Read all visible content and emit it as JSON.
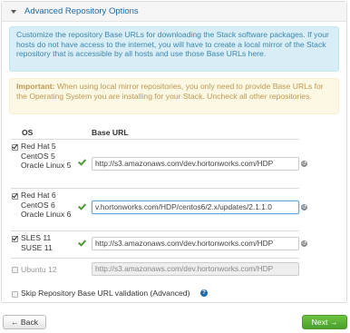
{
  "panel": {
    "title": "Advanced Repository Options",
    "info_text": "Customize the repository Base URLs for downloading the Stack software packages. If your hosts do not have access to the internet, you will have to create a local mirror of the Stack repository that is accessible by all hosts and use those Base URLs here.",
    "warning_label": "Important:",
    "warning_text": " When using local mirror repositories, you only need to provide Base URLs for the Operating System you are installing for your Stack. Uncheck all other repositories."
  },
  "table": {
    "col_os": "OS",
    "col_base_url": "Base URL",
    "rows": [
      {
        "os": "Red Hat 5\nCentOS 5\nOracle Linux 5",
        "url": "http://s3.amazonaws.com/dev.hortonworks.com/HDP",
        "checked": true
      },
      {
        "os": "Red Hat 6\nCentOS 6\nOracle Linux 6",
        "url": "v.hortonworks.com/HDP/centos6/2.x/updates/2.1.1.0",
        "checked": true
      },
      {
        "os": "SLES 11\nSUSE 11",
        "url": "http://s3.amazonaws.com/dev.hortonworks.com/HDP",
        "checked": true
      },
      {
        "os": "Ubuntu 12",
        "url": "http://s3.amazonaws.com/dev.hortonworks.com/HDP",
        "checked": false
      }
    ]
  },
  "skip_validation_label": "Skip Repository Base URL validation (Advanced)",
  "buttons": {
    "back": "← Back",
    "next": "Next →"
  },
  "colors": {
    "accent": "#1e6aa8",
    "success": "#4aa02c",
    "info_bg": "#d9edf7",
    "warning_bg": "#fcf8e3"
  }
}
